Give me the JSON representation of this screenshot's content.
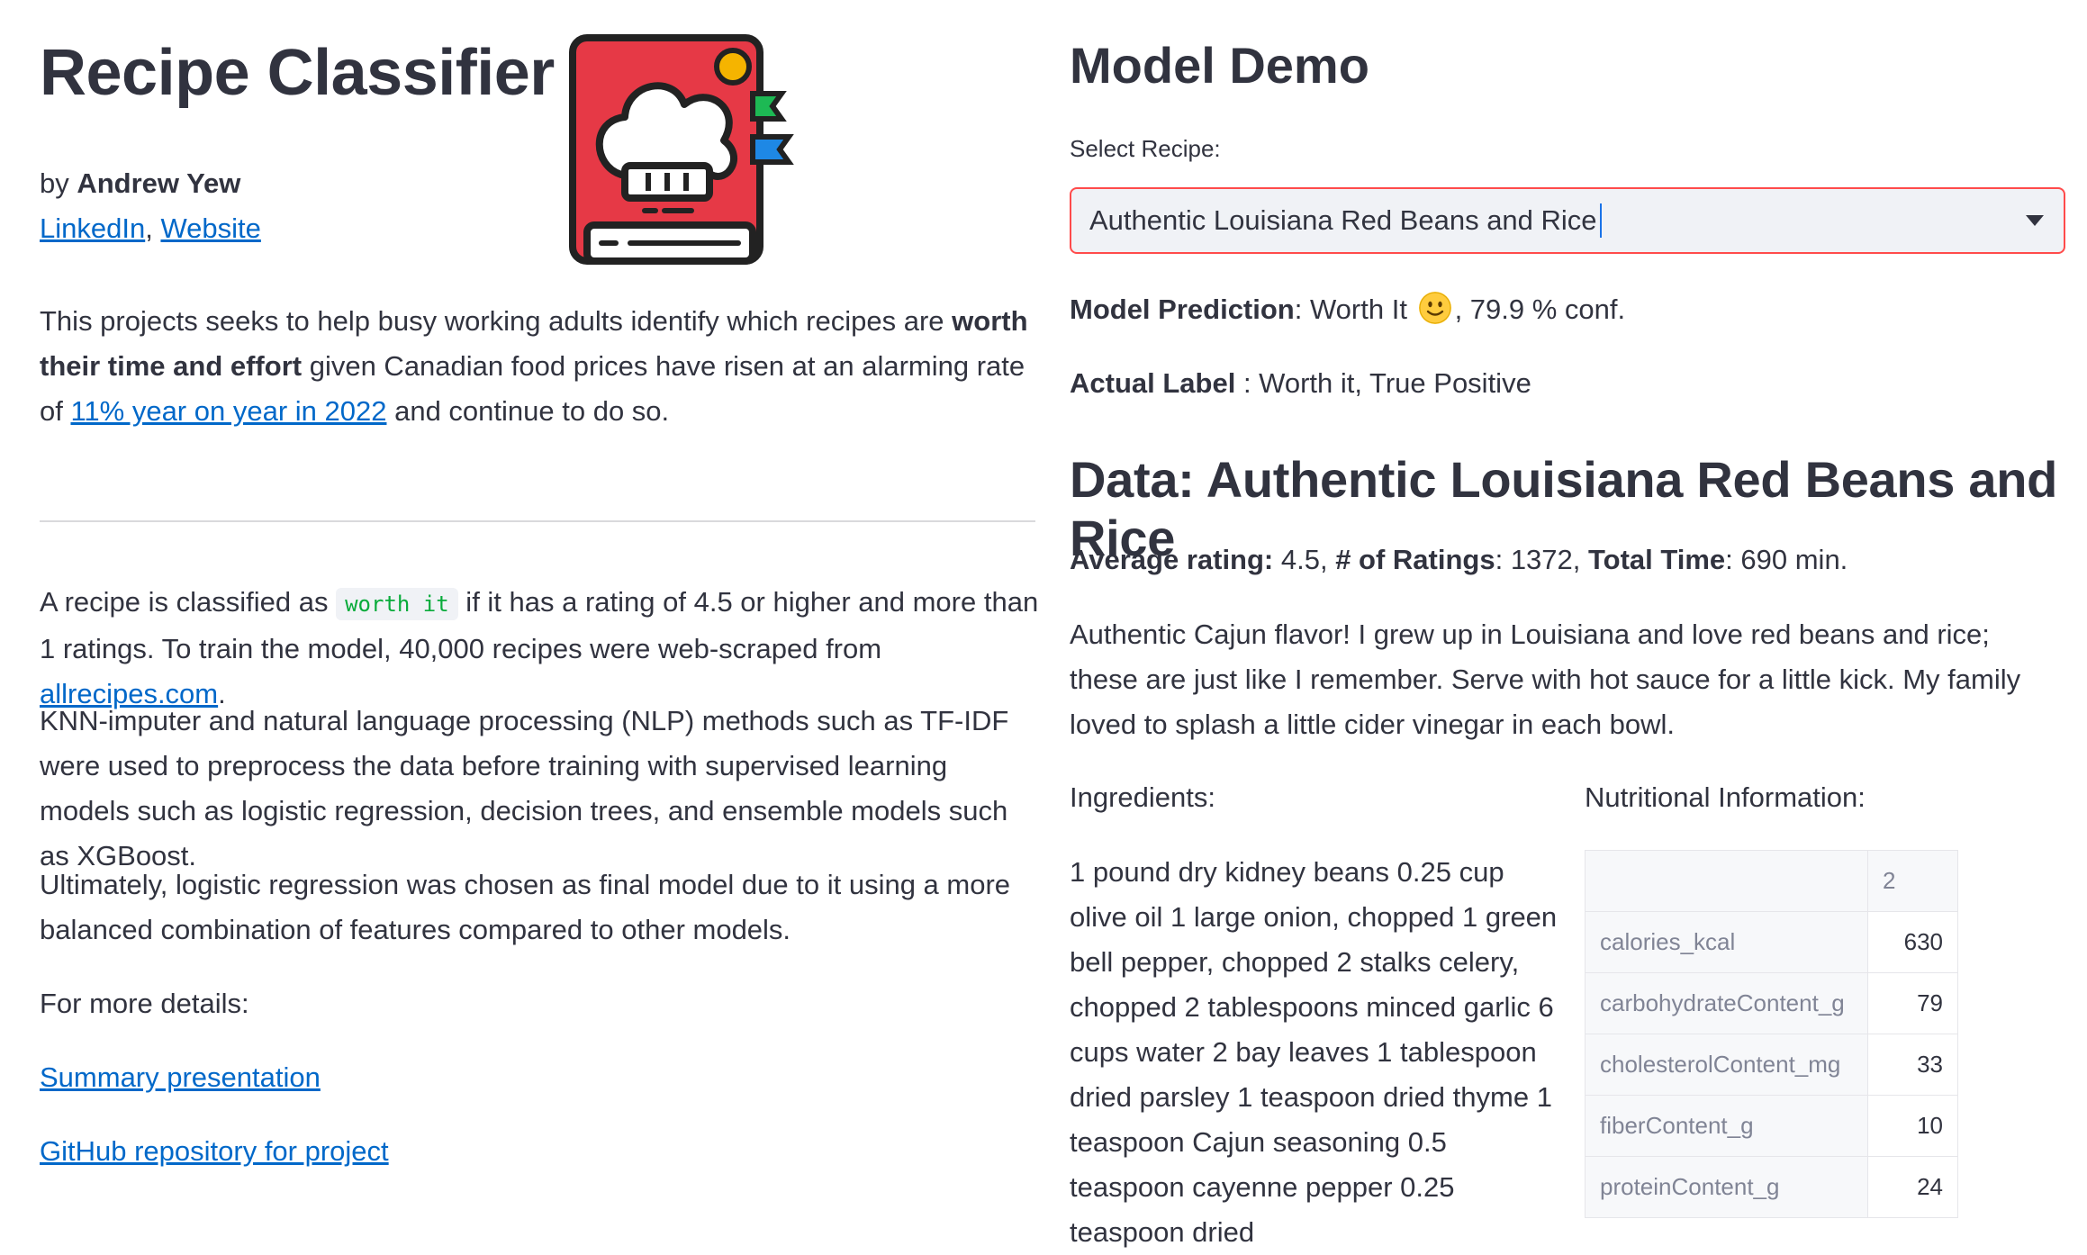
{
  "header": {
    "title": "Recipe Classifier",
    "by_prefix": "by ",
    "author": "Andrew Yew",
    "linkedin": "LinkedIn",
    "sep": ", ",
    "website": "Website"
  },
  "intro": {
    "p1_a": "This projects seeks to help busy working adults identify which recipes are ",
    "p1_b": "worth their time and effort",
    "p1_c": " given Canadian food prices have risen at an alarming rate of ",
    "p1_link": "11% year on year in 2022",
    "p1_d": " and continue to do so."
  },
  "body": {
    "p2_a": "A recipe is classified as ",
    "p2_code": "worth it",
    "p2_b": " if it has a rating of 4.5 or higher and more than 1 ratings. To train the model, 40,000 recipes were web-scraped from ",
    "p2_link": "allrecipes.com",
    "p2_c": ".",
    "p3": "KNN-imputer and natural language processing (NLP) methods such as TF-IDF were used to preprocess the data before training with supervised learning models such as logistic regression, decision trees, and ensemble models such as XGBoost.",
    "p4": "Ultimately, logistic regression was chosen as final model due to it using a more balanced combination of features compared to other models.",
    "p5": "For more details:",
    "link_summary": "Summary presentation",
    "link_github": "GitHub repository for project"
  },
  "demo": {
    "title": "Model Demo",
    "select_label": "Select Recipe:",
    "selected_recipe": "Authentic Louisiana Red Beans and Rice",
    "prediction_label": "Model Prediction",
    "prediction_value": ": Worth It",
    "prediction_conf": ", 79.9 % conf.",
    "actual_label": "Actual Label",
    "actual_value": " : Worth it, True Positive"
  },
  "data": {
    "title": "Data: Authentic Louisiana Red Beans and Rice",
    "avg_label": "Average rating:",
    "avg_value": " 4.5, ",
    "num_label": "# of Ratings",
    "num_value": ": 1372, ",
    "time_label": "Total Time",
    "time_value": ": 690 min.",
    "description": "Authentic Cajun flavor! I grew up in Louisiana and love red beans and rice; these are just like I remember. Serve with hot sauce for a little kick. My family loved to splash a little cider vinegar in each bowl.",
    "ingredients_label": "Ingredients:",
    "ingredients_text": "1 pound dry kidney beans 0.25 cup olive oil 1 large onion, chopped 1 green bell pepper, chopped 2 stalks celery, chopped 2 tablespoons minced garlic 6 cups water 2 bay leaves 1 tablespoon dried parsley 1 teaspoon dried thyme 1 teaspoon Cajun seasoning 0.5 teaspoon cayenne pepper 0.25 teaspoon dried",
    "nutrition_label": "Nutritional Information:",
    "nutrition_header": "2",
    "nutrition_rows": [
      {
        "key": "calories_kcal",
        "value": "630"
      },
      {
        "key": "carbohydrateContent_g",
        "value": "79"
      },
      {
        "key": "cholesterolContent_mg",
        "value": "33"
      },
      {
        "key": "fiberContent_g",
        "value": "10"
      },
      {
        "key": "proteinContent_g",
        "value": "24"
      }
    ]
  },
  "icons": {
    "logo": "recipe-book-chef-hat-icon",
    "dropdown": "chevron-down-icon",
    "emoji": "slightly-smiling-face-icon"
  },
  "colors": {
    "link": "#0068c9",
    "accent": "#ff4b4b",
    "book_red": "#e63946",
    "code_green": "#09ab3b"
  }
}
